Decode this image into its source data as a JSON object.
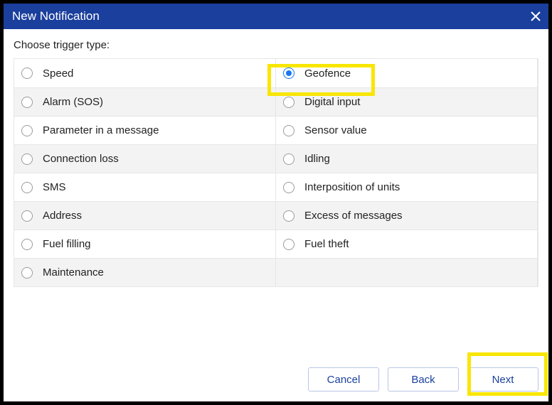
{
  "dialog": {
    "title": "New Notification",
    "prompt": "Choose trigger type:"
  },
  "triggers": {
    "rows": [
      {
        "left": "Speed",
        "right": "Geofence",
        "selected": "right"
      },
      {
        "left": "Alarm (SOS)",
        "right": "Digital input"
      },
      {
        "left": "Parameter in a message",
        "right": "Sensor value"
      },
      {
        "left": "Connection loss",
        "right": "Idling"
      },
      {
        "left": "SMS",
        "right": "Interposition of units"
      },
      {
        "left": "Address",
        "right": "Excess of messages"
      },
      {
        "left": "Fuel filling",
        "right": "Fuel theft"
      },
      {
        "left": "Maintenance",
        "right": ""
      }
    ]
  },
  "footer": {
    "cancel": "Cancel",
    "back": "Back",
    "next": "Next"
  }
}
